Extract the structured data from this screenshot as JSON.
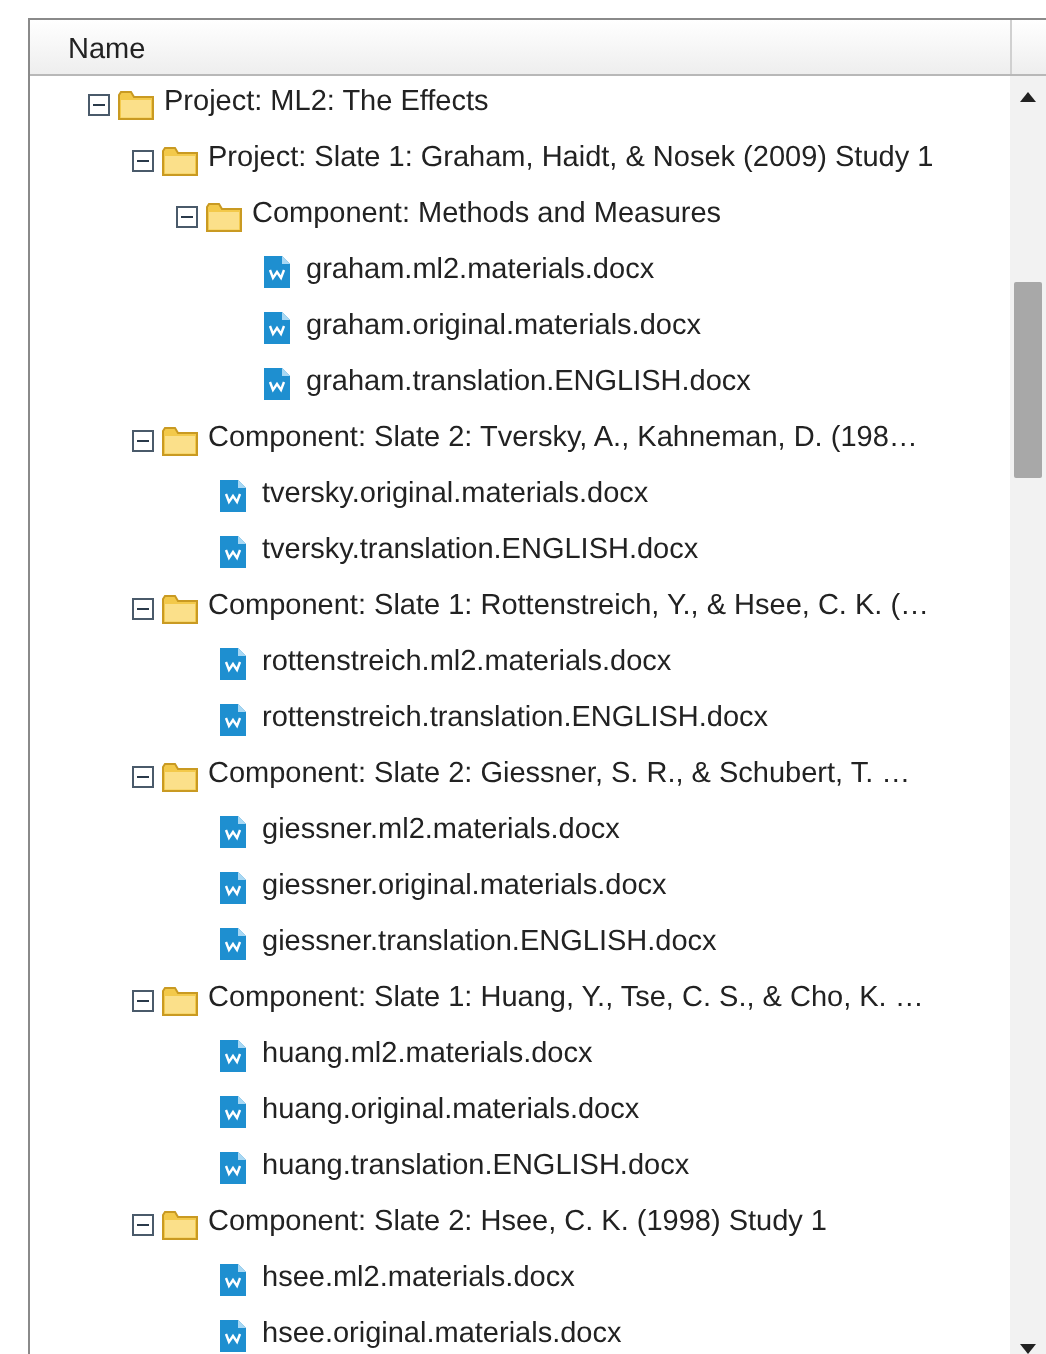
{
  "header": {
    "column": "Name"
  },
  "tree": [
    {
      "kind": "folder",
      "label": "Project: ML2: The Effects",
      "expanded": true,
      "children": [
        {
          "kind": "folder",
          "label": "Project: Slate 1: Graham, Haidt, & Nosek (2009) Study 1",
          "expanded": true,
          "children": [
            {
              "kind": "folder",
              "label": "Component: Methods and Measures",
              "expanded": true,
              "children": [
                {
                  "kind": "file",
                  "label": "graham.ml2.materials.docx"
                },
                {
                  "kind": "file",
                  "label": "graham.original.materials.docx"
                },
                {
                  "kind": "file",
                  "label": "graham.translation.ENGLISH.docx"
                }
              ]
            }
          ]
        },
        {
          "kind": "folder",
          "label": "Component: Slate 2: Tversky, A., Kahneman, D. (198…",
          "expanded": true,
          "children": [
            {
              "kind": "file",
              "label": "tversky.original.materials.docx"
            },
            {
              "kind": "file",
              "label": "tversky.translation.ENGLISH.docx"
            }
          ]
        },
        {
          "kind": "folder",
          "label": "Component: Slate 1: Rottenstreich, Y., & Hsee, C. K. (…",
          "expanded": true,
          "children": [
            {
              "kind": "file",
              "label": "rottenstreich.ml2.materials.docx"
            },
            {
              "kind": "file",
              "label": "rottenstreich.translation.ENGLISH.docx"
            }
          ]
        },
        {
          "kind": "folder",
          "label": "Component: Slate 2: Giessner, S. R., & Schubert, T. …",
          "expanded": true,
          "children": [
            {
              "kind": "file",
              "label": "giessner.ml2.materials.docx"
            },
            {
              "kind": "file",
              "label": "giessner.original.materials.docx"
            },
            {
              "kind": "file",
              "label": "giessner.translation.ENGLISH.docx"
            }
          ]
        },
        {
          "kind": "folder",
          "label": "Component: Slate 1: Huang, Y., Tse, C. S., & Cho, K. …",
          "expanded": true,
          "children": [
            {
              "kind": "file",
              "label": "huang.ml2.materials.docx"
            },
            {
              "kind": "file",
              "label": "huang.original.materials.docx"
            },
            {
              "kind": "file",
              "label": "huang.translation.ENGLISH.docx"
            }
          ]
        },
        {
          "kind": "folder",
          "label": "Component: Slate 2: Hsee, C. K. (1998) Study 1",
          "expanded": true,
          "children": [
            {
              "kind": "file",
              "label": "hsee.ml2.materials.docx"
            },
            {
              "kind": "file",
              "label": "hsee.original.materials.docx"
            }
          ]
        }
      ]
    }
  ]
}
